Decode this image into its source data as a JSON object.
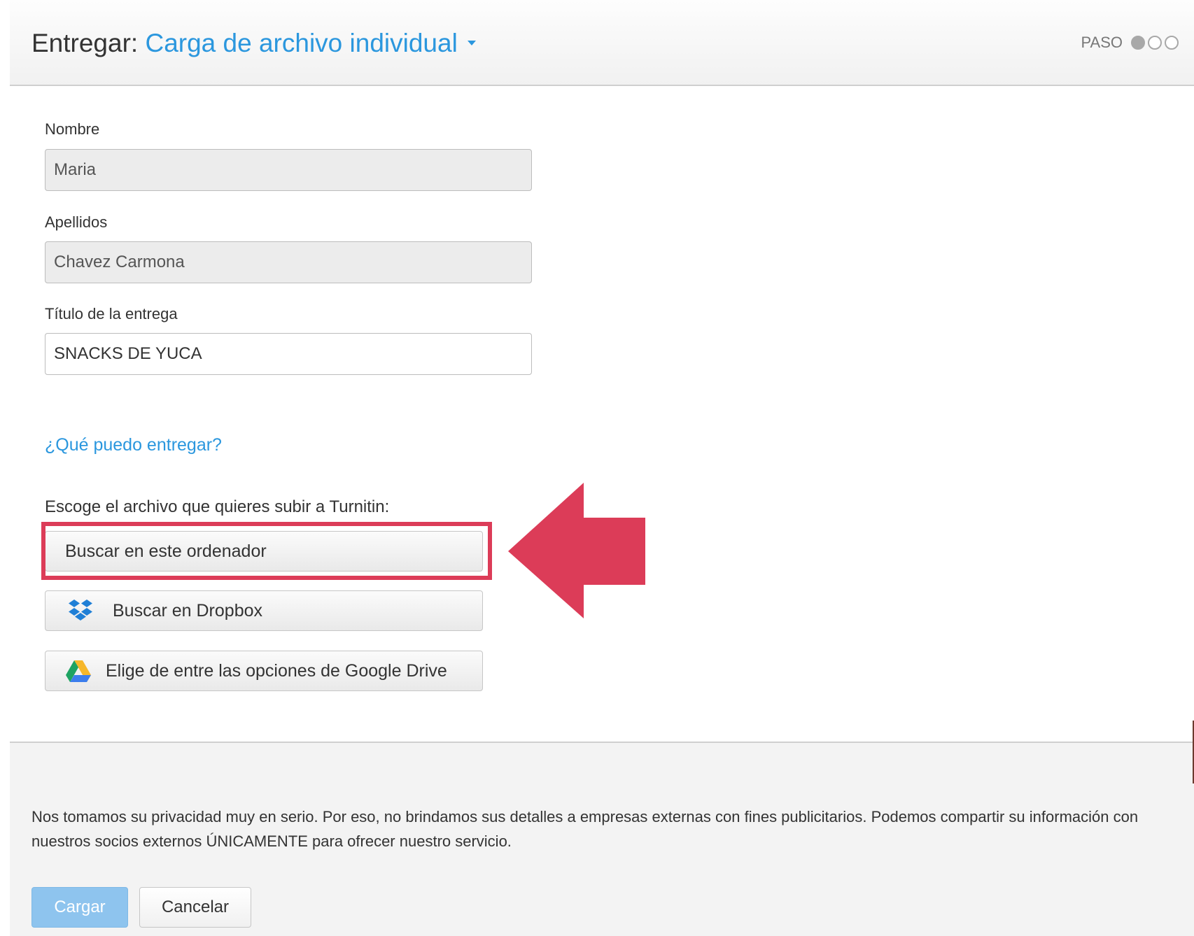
{
  "header": {
    "title_prefix": "Entregar:",
    "mode_label": "Carga de archivo individual",
    "step_label": "PASO",
    "steps": [
      {
        "state": "active"
      },
      {
        "state": "inactive"
      },
      {
        "state": "inactive"
      }
    ]
  },
  "form": {
    "first_name": {
      "label": "Nombre",
      "value": "Maria"
    },
    "last_name": {
      "label": "Apellidos",
      "value": "Chavez Carmona"
    },
    "submission_title": {
      "label": "Título de la entrega",
      "value": "SNACKS DE YUCA"
    },
    "help_link": "¿Qué puedo entregar?",
    "choose_file_text": "Escoge el archivo que quieres subir a Turnitin:",
    "upload_options": {
      "computer": "Buscar en este ordenador",
      "dropbox": "Buscar en Dropbox",
      "google_drive": "Elige de entre las opciones de Google Drive"
    }
  },
  "footer": {
    "privacy_text": "Nos tomamos su privacidad muy en serio. Por eso, no brindamos sus detalles a empresas externas con fines publicitarios. Podemos compartir su información con nuestros socios externos ÚNICAMENTE para ofrecer nuestro servicio.",
    "upload_button": "Cargar",
    "cancel_button": "Cancelar"
  },
  "colors": {
    "accent": "#2b97de",
    "annotation": "#dc3c58",
    "primary_disabled": "#8ec4ee"
  },
  "icons": [
    "caret-down-icon",
    "dropbox-icon",
    "google-drive-icon",
    "arrow-left-icon"
  ]
}
